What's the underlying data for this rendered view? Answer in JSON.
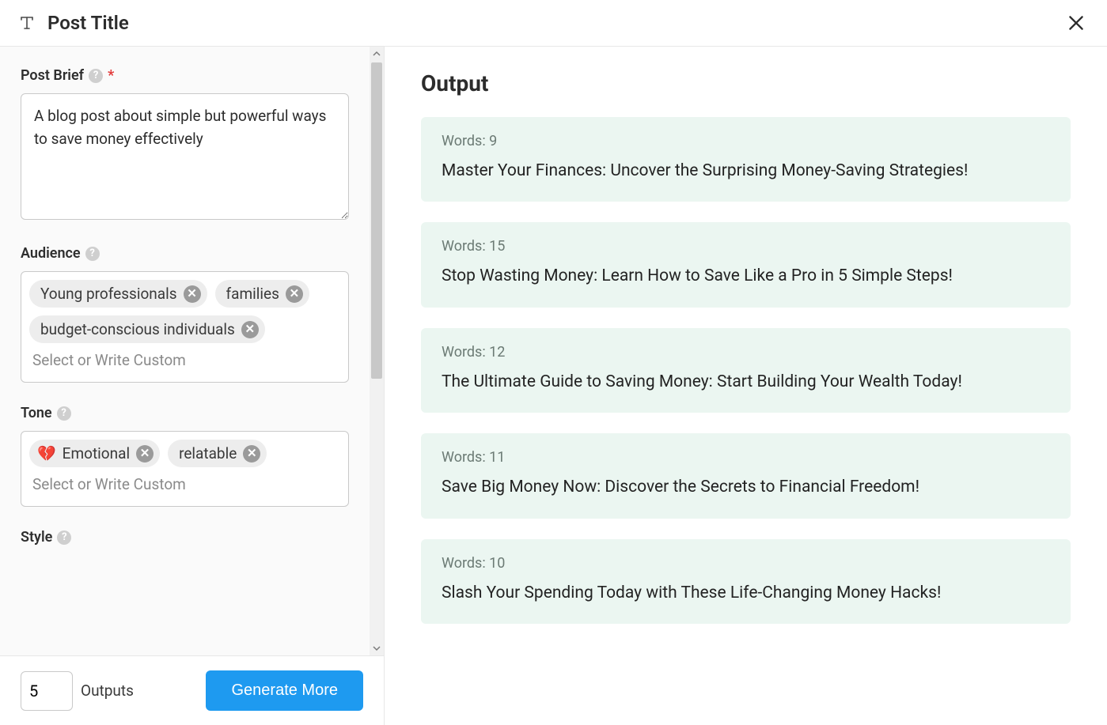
{
  "header": {
    "title": "Post Title"
  },
  "form": {
    "brief": {
      "label": "Post Brief",
      "required": "*",
      "value": "A blog post about simple but powerful ways to save money effectively"
    },
    "audience": {
      "label": "Audience",
      "tags": [
        {
          "label": "Young professionals"
        },
        {
          "label": "families"
        },
        {
          "label": "budget-conscious individuals"
        }
      ],
      "placeholder": "Select or Write Custom"
    },
    "tone": {
      "label": "Tone",
      "tags": [
        {
          "emoji": "💔",
          "label": "Emotional"
        },
        {
          "label": "relatable"
        }
      ],
      "placeholder": "Select or Write Custom"
    },
    "style": {
      "label": "Style"
    }
  },
  "footer": {
    "outputs_value": "5",
    "outputs_label": "Outputs",
    "generate_label": "Generate More"
  },
  "output": {
    "heading": "Output",
    "word_prefix": "Words: ",
    "items": [
      {
        "words": "9",
        "title": "Master Your Finances: Uncover the Surprising Money-Saving Strategies!"
      },
      {
        "words": "15",
        "title": "Stop Wasting Money: Learn How to Save Like a Pro in 5 Simple Steps!"
      },
      {
        "words": "12",
        "title": "The Ultimate Guide to Saving Money: Start Building Your Wealth Today!"
      },
      {
        "words": "11",
        "title": "Save Big Money Now: Discover the Secrets to Financial Freedom!"
      },
      {
        "words": "10",
        "title": "Slash Your Spending Today with These Life-Changing Money Hacks!"
      }
    ]
  }
}
